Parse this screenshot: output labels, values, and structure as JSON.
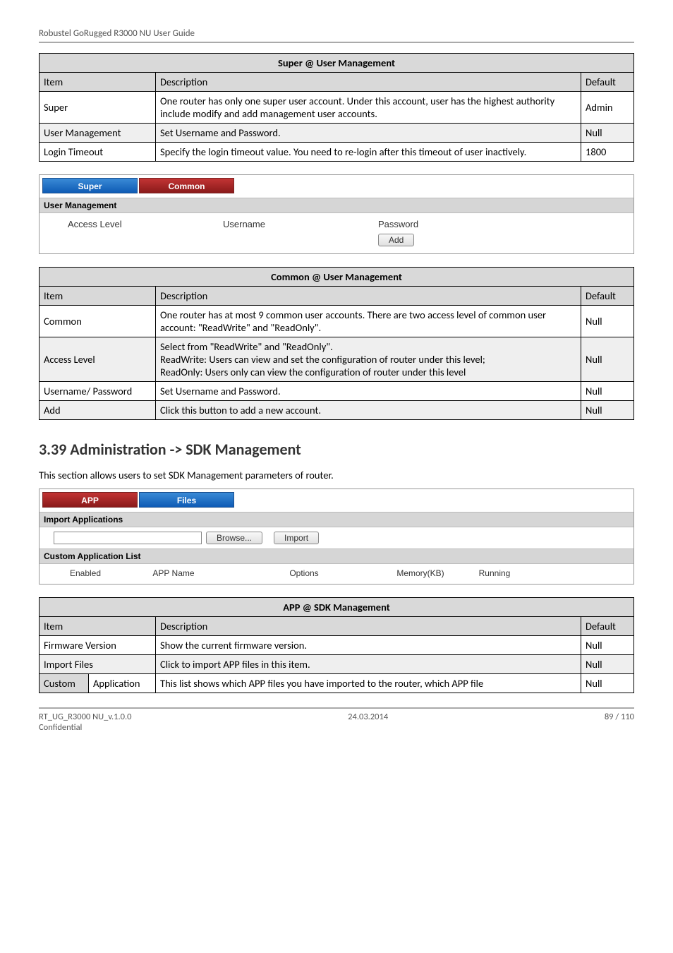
{
  "doc_header": "Robustel GoRugged R3000 NU User Guide",
  "table1": {
    "title": "Super @ User Management",
    "hdr_item": "Item",
    "hdr_desc": "Description",
    "hdr_def": "Default",
    "rows": [
      {
        "item": "Super",
        "desc": "One router has only one super user account. Under this account, user has the highest authority include modify and add management user accounts.",
        "def": "Admin"
      },
      {
        "item": "User Management",
        "desc": "Set Username and Password.",
        "def": "Null"
      },
      {
        "item": "Login Timeout",
        "desc": "Specify the login timeout value. You need to re-login after this timeout of user inactively.",
        "def": "1800"
      }
    ]
  },
  "shot1": {
    "tab_super": "Super",
    "tab_common": "Common",
    "section": "User Management",
    "col_access": "Access Level",
    "col_user": "Username",
    "col_pass": "Password",
    "btn_add": "Add"
  },
  "table2": {
    "title": "Common @ User Management",
    "hdr_item": "Item",
    "hdr_desc": "Description",
    "hdr_def": "Default",
    "rows": [
      {
        "item": "Common",
        "desc": "One router has at most 9 common user accounts. There are two access level of common user account: \"ReadWrite\" and \"ReadOnly\".",
        "def": "Null"
      },
      {
        "item": "Access Level",
        "desc": "Select from \"ReadWrite\" and \"ReadOnly\".\nReadWrite: Users can view and set the configuration of router under this level;\nReadOnly: Users only can view the configuration of router under this level",
        "def": "Null"
      },
      {
        "item": "Username/ Password",
        "desc": "Set Username and Password.",
        "def": "Null"
      },
      {
        "item": "Add",
        "desc": "Click this button to add a new account.",
        "def": "Null"
      }
    ]
  },
  "heading": "3.39  Administration -> SDK Management",
  "intro": "This section allows users to set SDK Management parameters of router.",
  "shot2": {
    "tab_app": "APP",
    "tab_files": "Files",
    "section_import": "Import Applications",
    "btn_browse": "Browse...",
    "btn_import": "Import",
    "section_custom": "Custom Application List",
    "col_enabled": "Enabled",
    "col_appname": "APP Name",
    "col_options": "Options",
    "col_mem": "Memory(KB)",
    "col_run": "Running"
  },
  "table3": {
    "title": "APP @ SDK Management",
    "hdr_item": "Item",
    "hdr_desc": "Description",
    "hdr_def": "Default",
    "rows": [
      {
        "item": "Firmware Version",
        "desc": "Show the current firmware version.",
        "def": "Null"
      },
      {
        "item": "Import Files",
        "desc": "Click to import APP files in this item.",
        "def": "Null"
      },
      {
        "item": "Custom Application",
        "desc": "This list shows which APP files you have imported to the router, which APP file",
        "def": "Null"
      }
    ],
    "app_label": "Application"
  },
  "footer": {
    "left": "RT_UG_R3000 NU_v.1.0.0",
    "center": "24.03.2014",
    "right": "89 / 110",
    "conf": "Confidential"
  }
}
